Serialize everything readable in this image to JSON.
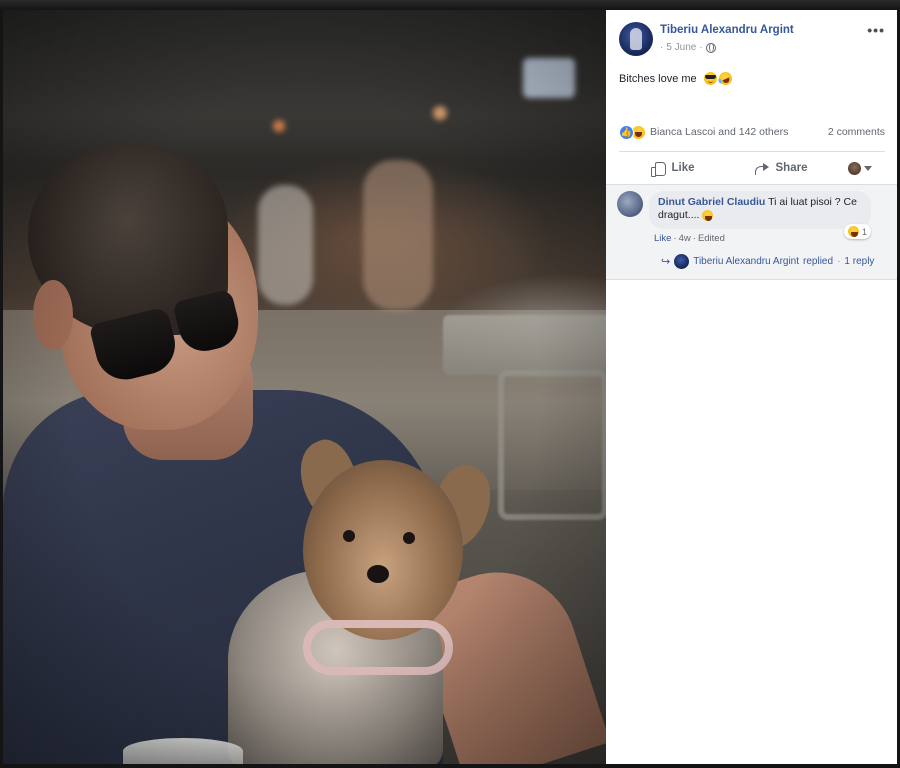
{
  "post": {
    "author": "Tiberiu Alexandru Argint",
    "date": "5 June",
    "date_separator": "·",
    "text": "Bitches love me",
    "text_emojis": [
      "sunglasses-emoji",
      "rofl-emoji"
    ],
    "more_icon": "more-options-icon",
    "privacy_icon": "globe-icon"
  },
  "reactions": {
    "types": [
      "like",
      "haha"
    ],
    "summary": "Bianca Lascoi and 142 others",
    "comments_count": "2 comments"
  },
  "actions": {
    "like": "Like",
    "share": "Share"
  },
  "comment": {
    "author": "Dinut Gabriel Claudiu",
    "text": "Ti ai luat pisoi ? Ce dragut....",
    "reaction_count": "1",
    "like_link": "Like",
    "separator": "·",
    "age": "4w",
    "edited": "Edited"
  },
  "reply_summary": {
    "author": "Tiberiu Alexandru Argint",
    "verb": "replied",
    "separator": "·",
    "count": "1 reply"
  },
  "colors": {
    "link": "#365899",
    "meta": "#90949c",
    "like_blue": "#3b82f6",
    "comment_bg": "#f2f3f5"
  }
}
